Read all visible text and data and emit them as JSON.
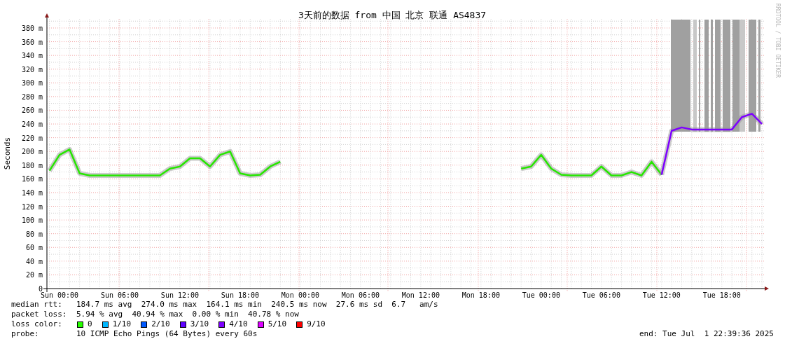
{
  "watermark_side": "RRDTOOL / TOBI OETIKER",
  "chart_data": {
    "type": "line",
    "title": "3天前的数据 from 中国 北京 联通 AS4837",
    "ylabel": "Seconds",
    "ylim": [
      0,
      393
    ],
    "grid": true,
    "categories": [
      null,
      "Sun 00:00",
      null,
      null,
      null,
      null,
      null,
      "Sun 06:00",
      null,
      null,
      null,
      null,
      null,
      "Sun 12:00",
      null,
      null,
      null,
      null,
      null,
      "Sun 18:00",
      null,
      null,
      null,
      null,
      null,
      "Mon 00:00",
      null,
      null,
      null,
      null,
      null,
      "Mon 06:00",
      null,
      null,
      null,
      null,
      null,
      "Mon 12:00",
      null,
      null,
      null,
      null,
      null,
      "Mon 18:00",
      null,
      null,
      null,
      null,
      null,
      "Tue 00:00",
      null,
      null,
      null,
      null,
      null,
      "Tue 06:00",
      null,
      null,
      null,
      null,
      null,
      "Tue 12:00",
      null,
      null,
      null,
      null,
      null,
      "Tue 18:00",
      null,
      null,
      null,
      null
    ],
    "series": [
      {
        "color": "#26e600",
        "values": [
          172,
          195,
          203,
          168,
          165,
          165,
          165,
          165,
          165,
          165,
          165,
          165,
          175,
          178,
          190,
          190,
          178,
          195,
          200,
          168,
          165,
          166,
          178,
          185,
          null,
          null,
          null,
          null,
          null,
          null,
          null,
          null,
          null,
          null,
          null,
          null,
          null,
          null,
          null,
          null,
          null,
          null,
          null,
          null,
          null,
          null,
          null,
          175,
          178,
          195,
          175,
          166,
          165,
          165,
          165,
          178,
          165,
          165,
          170,
          165,
          185,
          166,
          null,
          null,
          null,
          null,
          null,
          null,
          null,
          null,
          null,
          null
        ]
      },
      {
        "color": "#7e00ff",
        "values": [
          null,
          null,
          null,
          null,
          null,
          null,
          null,
          null,
          null,
          null,
          null,
          null,
          null,
          null,
          null,
          null,
          null,
          null,
          null,
          null,
          null,
          null,
          null,
          null,
          null,
          null,
          null,
          null,
          null,
          null,
          null,
          null,
          null,
          null,
          null,
          null,
          null,
          null,
          null,
          null,
          null,
          null,
          null,
          null,
          null,
          null,
          null,
          null,
          null,
          null,
          null,
          null,
          null,
          null,
          null,
          null,
          null,
          null,
          null,
          null,
          null,
          166,
          230,
          235,
          232,
          232,
          232,
          232,
          232,
          250,
          255,
          240
        ]
      }
    ],
    "yticks": [
      {
        "value": 0,
        "label": "0"
      },
      {
        "value": 20,
        "label": "20 m"
      },
      {
        "value": 40,
        "label": "40 m"
      },
      {
        "value": 60,
        "label": "60 m"
      },
      {
        "value": 80,
        "label": "80 m"
      },
      {
        "value": 100,
        "label": "100 m"
      },
      {
        "value": 120,
        "label": "120 m"
      },
      {
        "value": 140,
        "label": "140 m"
      },
      {
        "value": 160,
        "label": "160 m"
      },
      {
        "value": 180,
        "label": "180 m"
      },
      {
        "value": 200,
        "label": "200 m"
      },
      {
        "value": 220,
        "label": "220 m"
      },
      {
        "value": 240,
        "label": "240 m"
      },
      {
        "value": 260,
        "label": "260 m"
      },
      {
        "value": 280,
        "label": "280 m"
      },
      {
        "value": 300,
        "label": "300 m"
      },
      {
        "value": 320,
        "label": "320 m"
      },
      {
        "value": 340,
        "label": "340 m"
      },
      {
        "value": 360,
        "label": "360 m"
      },
      {
        "value": 380,
        "label": "380 m"
      }
    ]
  },
  "stats": [
    {
      "label": "median rtt:",
      "value": "184.7 ms avg  274.0 ms max  164.1 ms min  240.5 ms now  27.6 ms sd  6.7   am/s"
    },
    {
      "label": "packet loss:",
      "value": "5.94 % avg  40.94 % max  0.00 % min  40.78 % now"
    }
  ],
  "loss_legend": {
    "label": "loss color:",
    "items": [
      {
        "label": "0",
        "color": "#26ff00"
      },
      {
        "label": "1/10",
        "color": "#00b8ff"
      },
      {
        "label": "2/10",
        "color": "#0059ff"
      },
      {
        "label": "3/10",
        "color": "#5e00ff"
      },
      {
        "label": "4/10",
        "color": "#7e00ff"
      },
      {
        "label": "5/10",
        "color": "#dd00ff"
      },
      {
        "label": "9/10",
        "color": "#ff0000"
      }
    ]
  },
  "probe": {
    "label": "probe:",
    "value": "10 ICMP Echo Pings (64 Bytes) every 60s"
  },
  "end": "end: Tue Jul  1 22:39:36 2025"
}
